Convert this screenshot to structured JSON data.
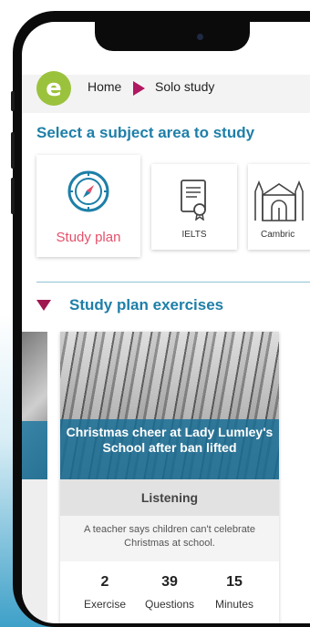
{
  "breadcrumb": {
    "home": "Home",
    "current": "Solo study"
  },
  "logo": {
    "letter": "e",
    "color": "#9bc23c"
  },
  "title": "Select a subject area to study",
  "subjects": [
    {
      "label": "Study plan",
      "icon": "compass-icon"
    },
    {
      "label": "IELTS",
      "icon": "certificate-icon"
    },
    {
      "label": "Cambric",
      "icon": "cathedral-icon"
    }
  ],
  "section": {
    "title": "Study plan exercises",
    "arrow_color": "#a0164f"
  },
  "card": {
    "headline": "Christmas cheer at Lady Lumley's School after ban lifted",
    "category": "Listening",
    "description": "A teacher says children can't celebrate Christmas at school.",
    "stats": [
      {
        "value": "2",
        "label": "Exercise"
      },
      {
        "value": "39",
        "label": "Questions"
      },
      {
        "value": "15",
        "label": "Minutes"
      }
    ]
  },
  "colors": {
    "accent": "#1e7fa8",
    "study_plan": "#e5506a",
    "breadcrumb_arrow": "#b01860"
  }
}
